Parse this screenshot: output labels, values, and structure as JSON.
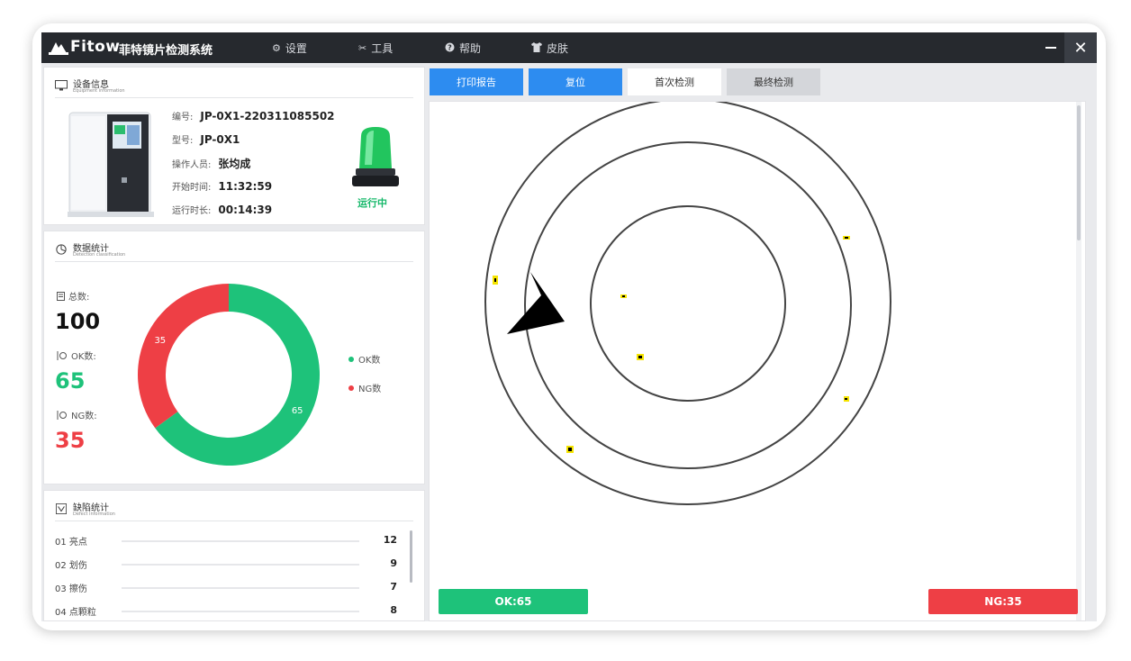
{
  "app": {
    "logo_text": "Fitow",
    "title": "菲特镜片检测系统",
    "menu": [
      {
        "icon": "gear-icon",
        "glyph": "⚙",
        "label": "设置"
      },
      {
        "icon": "tools-icon",
        "glyph": "✂",
        "label": "工具"
      },
      {
        "icon": "help-icon",
        "glyph": "❓",
        "label": "帮助"
      },
      {
        "icon": "skin-icon",
        "glyph": "👕",
        "label": "皮肤"
      }
    ],
    "close_glyph": "✕"
  },
  "device": {
    "title": "设备信息",
    "subtitle": "Equipment information",
    "fields": [
      {
        "label": "编号:",
        "value": "JP-0X1-220311085502"
      },
      {
        "label": "型号:",
        "value": "JP-0X1"
      },
      {
        "label": "操作人员:",
        "value": "张均成"
      },
      {
        "label": "开始时间:",
        "value": "11:32:59"
      },
      {
        "label": "运行时长:",
        "value": "00:14:39"
      }
    ],
    "status": "运行中"
  },
  "stats": {
    "title": "数据统计",
    "subtitle": "Detection classification",
    "total_label": "总数:",
    "total": "100",
    "ok_label": "OK数:",
    "ok": "65",
    "ng_label": "NG数:",
    "ng": "35",
    "legend_ok": "OK数",
    "legend_ng": "NG数",
    "colors": {
      "ok": "#1ec27a",
      "ng": "#ee3f45"
    }
  },
  "chart_data": {
    "type": "pie",
    "categories": [
      "OK数",
      "NG数"
    ],
    "values": [
      65,
      35
    ],
    "data_labels": [
      "65",
      "35"
    ],
    "legend": "right"
  },
  "defects": {
    "title": "缺陷统计",
    "subtitle": "Defect information",
    "items": [
      {
        "label": "01 亮点",
        "value": "12"
      },
      {
        "label": "02 划伤",
        "value": "9"
      },
      {
        "label": "03 擦伤",
        "value": "7"
      },
      {
        "label": "04 点颗粒",
        "value": "8"
      }
    ]
  },
  "toolbar": {
    "print": "打印报告",
    "reset": "复位",
    "first": "首次检测",
    "final": "最终检测"
  },
  "result": {
    "ok": "OK:65",
    "ng": "NG:35"
  },
  "colors": {
    "accent": "#2d8cf0",
    "ok": "#1ec27a",
    "ng": "#ee3f45",
    "titlebar": "#26292e"
  }
}
